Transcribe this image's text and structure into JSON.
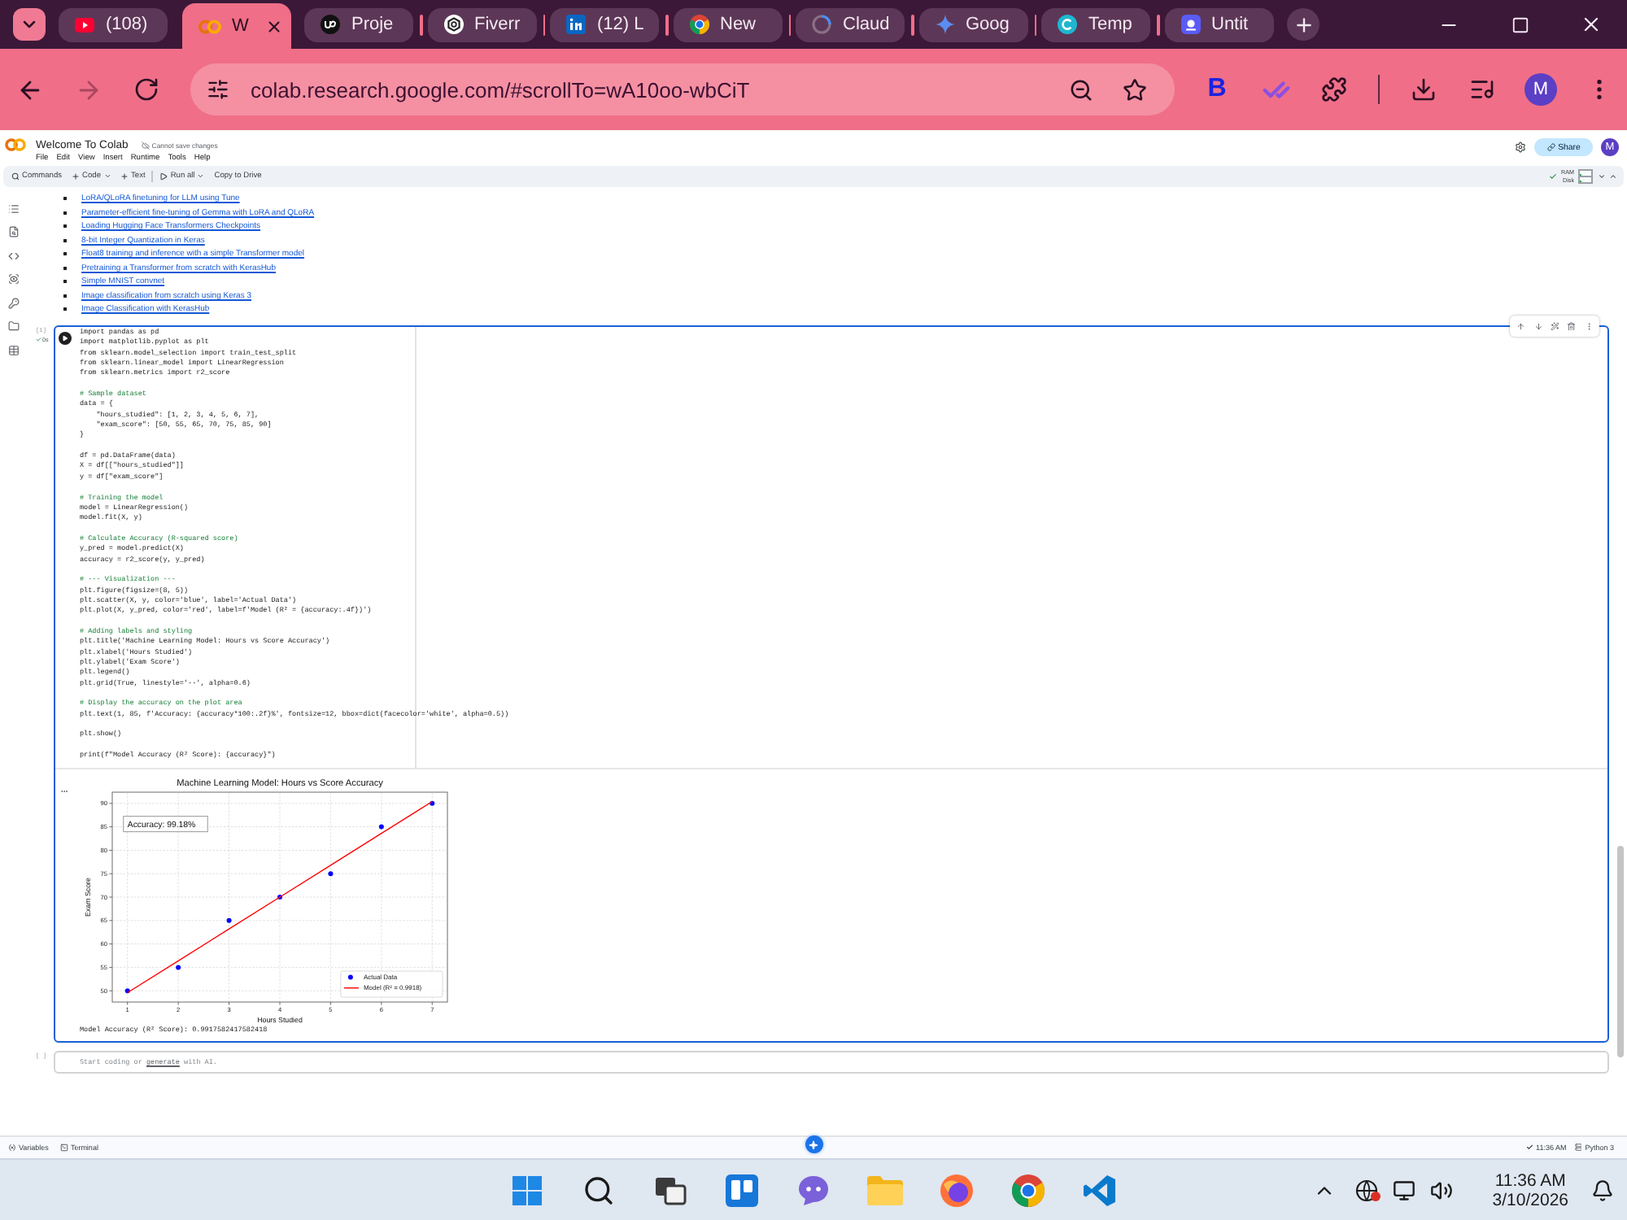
{
  "browser": {
    "tabs": [
      {
        "title": "(108)",
        "selected": false
      },
      {
        "title": "W",
        "selected": true
      },
      {
        "title": "Proje",
        "selected": false
      },
      {
        "title": "Fiverr",
        "selected": false
      },
      {
        "title": "(12) L",
        "selected": false
      },
      {
        "title": "New",
        "selected": false
      },
      {
        "title": "Claud",
        "selected": false
      },
      {
        "title": "Goog",
        "selected": false
      },
      {
        "title": "Temp",
        "selected": false
      },
      {
        "title": "Untit",
        "selected": false
      }
    ],
    "url": "colab.research.google.com/#scrollTo=wA10oo-wbCiT",
    "extension_letter": "B",
    "profile_initial": "M"
  },
  "notebook": {
    "title": "Welcome To Colab",
    "save_status": "Cannot save changes",
    "menu": [
      "File",
      "Edit",
      "View",
      "Insert",
      "Runtime",
      "Tools",
      "Help"
    ],
    "share_label": "Share",
    "avatar_initial": "M",
    "toolbar": [
      {
        "label": "Commands",
        "kind": "search",
        "dropdown": false
      },
      {
        "label": "Code",
        "kind": "add",
        "dropdown": true
      },
      {
        "label": "Text",
        "kind": "add",
        "dropdown": false
      },
      {
        "label": "Run all",
        "kind": "run",
        "dropdown": true
      },
      {
        "label": "Copy to Drive",
        "kind": "plain",
        "dropdown": false
      }
    ],
    "resources": [
      {
        "label": "RAM",
        "level": 0.1
      },
      {
        "label": "Disk",
        "level": 0.2
      }
    ],
    "links": [
      "LoRA/QLoRA finetuning for LLM using Tune",
      "Parameter-efficient fine-tuning of Gemma with LoRA and QLoRA",
      "Loading Hugging Face Transformers Checkpoints",
      "8-bit Integer Quantization in Keras",
      "Float8 training and inference with a simple Transformer model",
      "Pretraining a Transformer from scratch with KerasHub",
      "Simple MNIST convnet",
      "Image classification from scratch using Keras 3",
      "Image Classification with KerasHub"
    ],
    "code_cell": {
      "execution_count": "[1]",
      "run_time": "0s",
      "blocks": [
        [
          {
            "kind": "code",
            "text": "import pandas as pd"
          },
          {
            "kind": "code",
            "text": "import matplotlib.pyplot as plt"
          },
          {
            "kind": "code",
            "text": "from sklearn.model_selection import train_test_split"
          },
          {
            "kind": "code",
            "text": "from sklearn.linear_model import LinearRegression"
          },
          {
            "kind": "code",
            "text": "from sklearn.metrics import r2_score"
          }
        ],
        [
          {
            "kind": "comment",
            "text": "# Sample dataset"
          },
          {
            "kind": "code",
            "text": "data = {"
          },
          {
            "kind": "code",
            "text": "    \"hours_studied\": [1, 2, 3, 4, 5, 6, 7],"
          },
          {
            "kind": "code",
            "text": "    \"exam_score\": [50, 55, 65, 70, 75, 85, 90]"
          },
          {
            "kind": "code",
            "text": "}"
          }
        ],
        [
          {
            "kind": "code",
            "text": "df = pd.DataFrame(data)"
          },
          {
            "kind": "code",
            "text": "X = df[[\"hours_studied\"]]"
          },
          {
            "kind": "code",
            "text": "y = df[\"exam_score\"]"
          }
        ],
        [
          {
            "kind": "comment",
            "text": "# Training the model"
          },
          {
            "kind": "code",
            "text": "model = LinearRegression()"
          },
          {
            "kind": "code",
            "text": "model.fit(X, y)"
          }
        ],
        [
          {
            "kind": "comment",
            "text": "# Calculate Accuracy (R-squared score)"
          },
          {
            "kind": "code",
            "text": "y_pred = model.predict(X)"
          },
          {
            "kind": "code",
            "text": "accuracy = r2_score(y, y_pred)"
          }
        ],
        [
          {
            "kind": "comment",
            "text": "# --- Visualization ---"
          },
          {
            "kind": "code",
            "text": "plt.figure(figsize=(8, 5))"
          },
          {
            "kind": "code",
            "text": "plt.scatter(X, y, color='blue', label='Actual Data')"
          },
          {
            "kind": "code",
            "text": "plt.plot(X, y_pred, color='red', label=f'Model (R² = {accuracy:.4f})')"
          }
        ],
        [
          {
            "kind": "comment",
            "text": "# Adding labels and styling"
          },
          {
            "kind": "code",
            "text": "plt.title('Machine Learning Model: Hours vs Score Accuracy')"
          },
          {
            "kind": "code",
            "text": "plt.xlabel('Hours Studied')"
          },
          {
            "kind": "code",
            "text": "plt.ylabel('Exam Score')"
          },
          {
            "kind": "code",
            "text": "plt.legend()"
          },
          {
            "kind": "code",
            "text": "plt.grid(True, linestyle='--', alpha=0.6)"
          }
        ],
        [
          {
            "kind": "comment",
            "text": "# Display the accuracy on the plot area"
          },
          {
            "kind": "code",
            "text": "plt.text(1, 85, f'Accuracy: {accuracy*100:.2f}%', fontsize=12, bbox=dict(facecolor='white', alpha=0.5))"
          }
        ],
        [
          {
            "kind": "code",
            "text": "plt.show()"
          }
        ],
        [
          {
            "kind": "code",
            "text": "print(f\"Model Accuracy (R² Score): {accuracy}\")"
          }
        ]
      ],
      "output": {
        "chart_data": {
          "type": "scatter",
          "title": "Machine Learning Model: Hours vs Score Accuracy",
          "xlabel": "Hours Studied",
          "ylabel": "Exam Score",
          "x": [
            1,
            2,
            3,
            4,
            5,
            6,
            7
          ],
          "series": [
            {
              "name": "Actual Data",
              "type": "scatter",
              "color": "#0000ff",
              "values": [
                50,
                55,
                65,
                70,
                75,
                85,
                90
              ]
            },
            {
              "name": "Model (R² = 0.9918)",
              "type": "line",
              "color": "#ff0000",
              "values": [
                49.6,
                56.4,
                63.2,
                70,
                76.8,
                83.6,
                90.4
              ]
            }
          ],
          "xlim": [
            0.7,
            7.3
          ],
          "ylim": [
            47.6,
            92.4
          ],
          "xticks": [
            1,
            2,
            3,
            4,
            5,
            6,
            7
          ],
          "yticks": [
            50,
            55,
            60,
            65,
            70,
            75,
            80,
            85,
            90
          ],
          "grid": true,
          "legend": "lower right",
          "annotations": [
            "Accuracy: 99.18%"
          ]
        },
        "text": "Model Accuracy (R² Score): 0.9917582417582418"
      }
    },
    "empty_cell": {
      "execution_count": "[ ]",
      "prompt_start": "Start coding or ",
      "prompt_link": "generate",
      "prompt_end": " with AI."
    }
  },
  "status_bar": {
    "variables": "Variables",
    "terminal": "Terminal",
    "time": "11:36 AM",
    "runtime": "Python 3"
  },
  "taskbar": {
    "time": "11:36 AM",
    "date": "3/10/2026"
  }
}
